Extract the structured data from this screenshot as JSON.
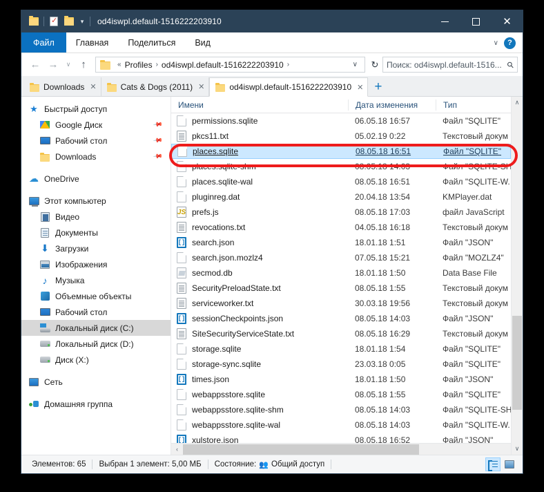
{
  "window": {
    "title": "od4iswpl.default-1516222203910",
    "quick_access": [
      {
        "name": "folder-icon",
        "label": "Folder"
      },
      {
        "name": "properties-icon",
        "label": "Properties"
      },
      {
        "name": "new-folder-icon",
        "label": "New folder"
      },
      {
        "name": "customize-chevron-icon",
        "label": "Customize Quick Access Toolbar"
      }
    ],
    "controls": {
      "minimize": "–",
      "maximize": "□",
      "close": "✕"
    }
  },
  "ribbon": {
    "tabs": [
      {
        "label": "Файл",
        "active": true
      },
      {
        "label": "Главная",
        "active": false
      },
      {
        "label": "Поделиться",
        "active": false
      },
      {
        "label": "Вид",
        "active": false
      }
    ],
    "collapse_chevron": "∨",
    "help_label": "?"
  },
  "address_bar": {
    "back": "←",
    "forward": "→",
    "recent": "∨",
    "up": "↑",
    "crumb_prefix": "«",
    "crumbs": [
      "Profiles",
      "od4iswpl.default-1516222203910"
    ],
    "crumb_sep": "›",
    "dropdown": "∨",
    "refresh": "↻",
    "search_value": "Поиск: od4iswpl.default-1516...",
    "search_icon": "⚲"
  },
  "tabstrip": {
    "tabs": [
      {
        "label": "Downloads",
        "active": false,
        "close": "✕"
      },
      {
        "label": "Cats & Dogs (2011)",
        "active": false,
        "close": "✕"
      },
      {
        "label": "od4iswpl.default-1516222203910",
        "active": true,
        "close": "✕"
      }
    ],
    "new_tab": "+"
  },
  "sidebar": {
    "items": [
      {
        "label": "Быстрый доступ",
        "icon": "star-icon",
        "indent": 0,
        "pinned": false,
        "selected": false
      },
      {
        "label": "Google Диск",
        "icon": "google-drive-icon",
        "indent": 1,
        "pinned": true,
        "selected": false
      },
      {
        "label": "Рабочий стол",
        "icon": "desktop-icon",
        "indent": 1,
        "pinned": true,
        "selected": false
      },
      {
        "label": "Downloads",
        "icon": "folder-icon",
        "indent": 1,
        "pinned": true,
        "selected": false
      },
      {
        "label": "OneDrive",
        "icon": "cloud-icon",
        "indent": 0,
        "pinned": false,
        "selected": false
      },
      {
        "label": "Этот компьютер",
        "icon": "computer-icon",
        "indent": 0,
        "pinned": false,
        "selected": false
      },
      {
        "label": "Видео",
        "icon": "video-icon",
        "indent": 1,
        "pinned": false,
        "selected": false
      },
      {
        "label": "Документы",
        "icon": "documents-icon",
        "indent": 1,
        "pinned": false,
        "selected": false
      },
      {
        "label": "Загрузки",
        "icon": "downloads-arrow-icon",
        "indent": 1,
        "pinned": false,
        "selected": false
      },
      {
        "label": "Изображения",
        "icon": "pictures-icon",
        "indent": 1,
        "pinned": false,
        "selected": false
      },
      {
        "label": "Музыка",
        "icon": "music-icon",
        "indent": 1,
        "pinned": false,
        "selected": false
      },
      {
        "label": "Объемные объекты",
        "icon": "3d-objects-icon",
        "indent": 1,
        "pinned": false,
        "selected": false
      },
      {
        "label": "Рабочий стол",
        "icon": "desktop-icon",
        "indent": 1,
        "pinned": false,
        "selected": false
      },
      {
        "label": "Локальный диск (C:)",
        "icon": "system-drive-icon",
        "indent": 1,
        "pinned": false,
        "selected": true
      },
      {
        "label": "Локальный диск (D:)",
        "icon": "drive-icon",
        "indent": 1,
        "pinned": false,
        "selected": false
      },
      {
        "label": "Диск (X:)",
        "icon": "drive-icon",
        "indent": 1,
        "pinned": false,
        "selected": false
      },
      {
        "label": "Сеть",
        "icon": "network-icon",
        "indent": 0,
        "pinned": false,
        "selected": false
      },
      {
        "label": "Домашняя группа",
        "icon": "homegroup-icon",
        "indent": 0,
        "pinned": false,
        "selected": false
      }
    ]
  },
  "file_list": {
    "columns": [
      {
        "label": "Имени"
      },
      {
        "label": "Дата изменения"
      },
      {
        "label": "Тип"
      }
    ],
    "sort_indicator": "∧",
    "rows": [
      {
        "name": "permissions.sqlite",
        "date": "06.05.18 16:57",
        "type": "Файл \"SQLITE\"",
        "icon": "generic-file-icon",
        "selected": false
      },
      {
        "name": "pkcs11.txt",
        "date": "05.02.19 0:22",
        "type": "Текстовый докум",
        "icon": "text-file-icon",
        "selected": false
      },
      {
        "name": "places.sqlite",
        "date": "08.05.18 16:51",
        "type": "Файл \"SQLITE\"",
        "icon": "generic-file-icon",
        "selected": true
      },
      {
        "name": "places.sqlite-shm",
        "date": "08.05.18 14:03",
        "type": "Файл \"SQLITE-SH",
        "icon": "generic-file-icon",
        "selected": false
      },
      {
        "name": "places.sqlite-wal",
        "date": "08.05.18 16:51",
        "type": "Файл \"SQLITE-W.",
        "icon": "generic-file-icon",
        "selected": false
      },
      {
        "name": "pluginreg.dat",
        "date": "20.04.18 13:54",
        "type": "KMPlayer.dat",
        "icon": "generic-file-icon",
        "selected": false
      },
      {
        "name": "prefs.js",
        "date": "08.05.18 17:03",
        "type": "файл JavaScript",
        "icon": "javascript-file-icon",
        "selected": false
      },
      {
        "name": "revocations.txt",
        "date": "04.05.18 16:18",
        "type": "Текстовый докум",
        "icon": "text-file-icon",
        "selected": false
      },
      {
        "name": "search.json",
        "date": "18.01.18 1:51",
        "type": "Файл \"JSON\"",
        "icon": "json-file-icon",
        "selected": false
      },
      {
        "name": "search.json.mozlz4",
        "date": "07.05.18 15:21",
        "type": "Файл \"MOZLZ4\"",
        "icon": "generic-file-icon",
        "selected": false
      },
      {
        "name": "secmod.db",
        "date": "18.01.18 1:50",
        "type": "Data Base File",
        "icon": "database-file-icon",
        "selected": false
      },
      {
        "name": "SecurityPreloadState.txt",
        "date": "08.05.18 1:55",
        "type": "Текстовый докум",
        "icon": "text-file-icon",
        "selected": false
      },
      {
        "name": "serviceworker.txt",
        "date": "30.03.18 19:56",
        "type": "Текстовый докум",
        "icon": "text-file-icon",
        "selected": false
      },
      {
        "name": "sessionCheckpoints.json",
        "date": "08.05.18 14:03",
        "type": "Файл \"JSON\"",
        "icon": "json-file-icon",
        "selected": false
      },
      {
        "name": "SiteSecurityServiceState.txt",
        "date": "08.05.18 16:29",
        "type": "Текстовый докум",
        "icon": "text-file-icon",
        "selected": false
      },
      {
        "name": "storage.sqlite",
        "date": "18.01.18 1:54",
        "type": "Файл \"SQLITE\"",
        "icon": "generic-file-icon",
        "selected": false
      },
      {
        "name": "storage-sync.sqlite",
        "date": "23.03.18 0:05",
        "type": "Файл \"SQLITE\"",
        "icon": "generic-file-icon",
        "selected": false
      },
      {
        "name": "times.json",
        "date": "18.01.18 1:50",
        "type": "Файл \"JSON\"",
        "icon": "json-file-icon",
        "selected": false
      },
      {
        "name": "webappsstore.sqlite",
        "date": "08.05.18 1:55",
        "type": "Файл \"SQLITE\"",
        "icon": "generic-file-icon",
        "selected": false
      },
      {
        "name": "webappsstore.sqlite-shm",
        "date": "08.05.18 14:03",
        "type": "Файл \"SQLITE-SH",
        "icon": "generic-file-icon",
        "selected": false
      },
      {
        "name": "webappsstore.sqlite-wal",
        "date": "08.05.18 14:03",
        "type": "Файл \"SQLITE-W.",
        "icon": "generic-file-icon",
        "selected": false
      },
      {
        "name": "xulstore.json",
        "date": "08.05.18 16:52",
        "type": "Файл \"JSON\"",
        "icon": "json-file-icon",
        "selected": false
      }
    ],
    "scroll_up": "∧",
    "scroll_down": "∨",
    "scroll_left": "‹",
    "scroll_right": "›"
  },
  "statusbar": {
    "items_count": "Элементов: 65",
    "selection": "Выбран 1 элемент: 5,00 МБ",
    "state_label": "Состояние:",
    "sharing": "Общий доступ",
    "sharing_icon": "👥",
    "view_details": "details-view",
    "view_icons": "icons-view"
  },
  "colors": {
    "titlebar": "#2b4257",
    "file_tab_accent": "#0b71c1",
    "selection": "#cce8ff",
    "annotation": "#ee1c1c",
    "column_header_text": "#29527a"
  }
}
